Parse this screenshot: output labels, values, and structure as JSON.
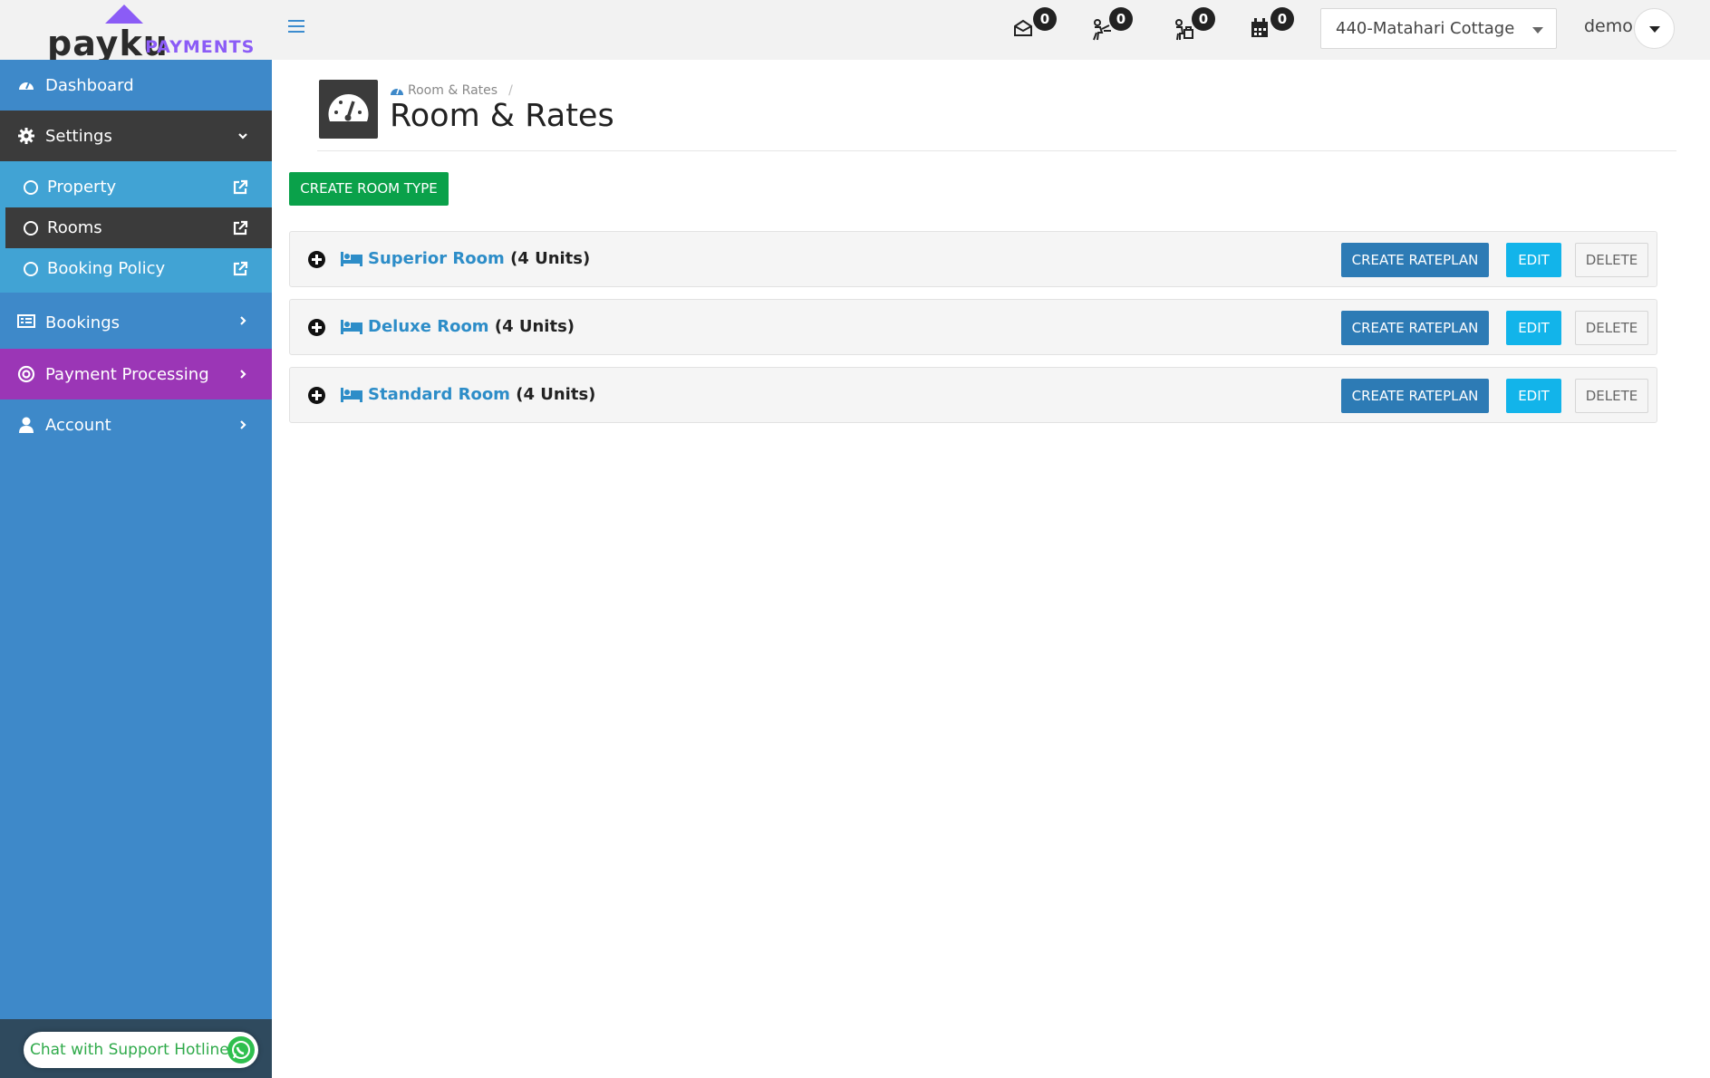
{
  "brand": {
    "name": "payku",
    "sub": "PAYMENTS",
    "accent": "#8b5cf6"
  },
  "header": {
    "notifications": [
      {
        "icon": "envelope-icon",
        "count": "0"
      },
      {
        "icon": "checkin-icon",
        "count": "0"
      },
      {
        "icon": "checkout-icon",
        "count": "0"
      },
      {
        "icon": "calendar-icon",
        "count": "0"
      }
    ],
    "property": "440-Matahari Cottage",
    "user": "demo"
  },
  "sidebar": {
    "dashboard": "Dashboard",
    "settings": "Settings",
    "submenu": [
      {
        "label": "Property"
      },
      {
        "label": "Rooms"
      },
      {
        "label": "Booking Policy"
      }
    ],
    "bookings": "Bookings",
    "payment": "Payment Processing",
    "account": "Account",
    "support": "Chat with Support Hotline"
  },
  "page": {
    "breadcrumb": "Room & Rates",
    "title": "Room & Rates",
    "create_button": "CREATE ROOM TYPE"
  },
  "rooms": [
    {
      "name": "Superior Room",
      "units": "(4 Units)"
    },
    {
      "name": "Deluxe Room",
      "units": "(4 Units)"
    },
    {
      "name": "Standard Room",
      "units": "(4 Units)"
    }
  ],
  "room_actions": {
    "rateplan": "CREATE RATEPLAN",
    "edit": "EDIT",
    "delete": "DELETE"
  },
  "colors": {
    "sidebar": "#3e89c9",
    "submenu": "#41a3d4",
    "active": "#3b3b3b",
    "payment": "#9b36b6",
    "create_green": "#0aa14a",
    "rateplan_blue": "#2d7bb5",
    "edit_cyan": "#12b4ea"
  }
}
